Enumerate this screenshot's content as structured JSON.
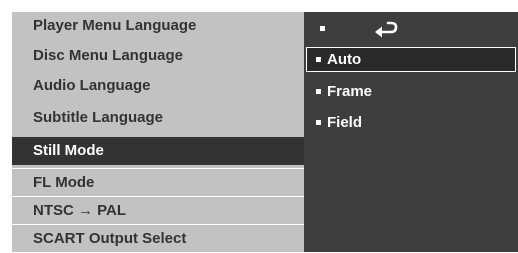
{
  "setup_menu": {
    "items": [
      {
        "label": "Player Menu Language"
      },
      {
        "label": "Disc Menu Language"
      },
      {
        "label": "Audio Language"
      },
      {
        "label": "Subtitle Language"
      },
      {
        "label": "Still Mode"
      },
      {
        "label": "FL Mode"
      },
      {
        "label": "NTSC → PAL"
      },
      {
        "label": "SCART Output Select"
      }
    ],
    "selected_item": "Still Mode"
  },
  "submenu": {
    "return_icon": "return-arrow-icon",
    "options": [
      {
        "label": "Auto"
      },
      {
        "label": "Frame"
      },
      {
        "label": "Field"
      }
    ],
    "selected_option": "Auto"
  },
  "colors": {
    "menu_background": "#c2c2c2",
    "menu_text": "#333333",
    "selected_background": "#333333",
    "selected_text": "#ffffff",
    "submenu_background": "#3e3e3e",
    "submenu_text": "#ffffff"
  }
}
